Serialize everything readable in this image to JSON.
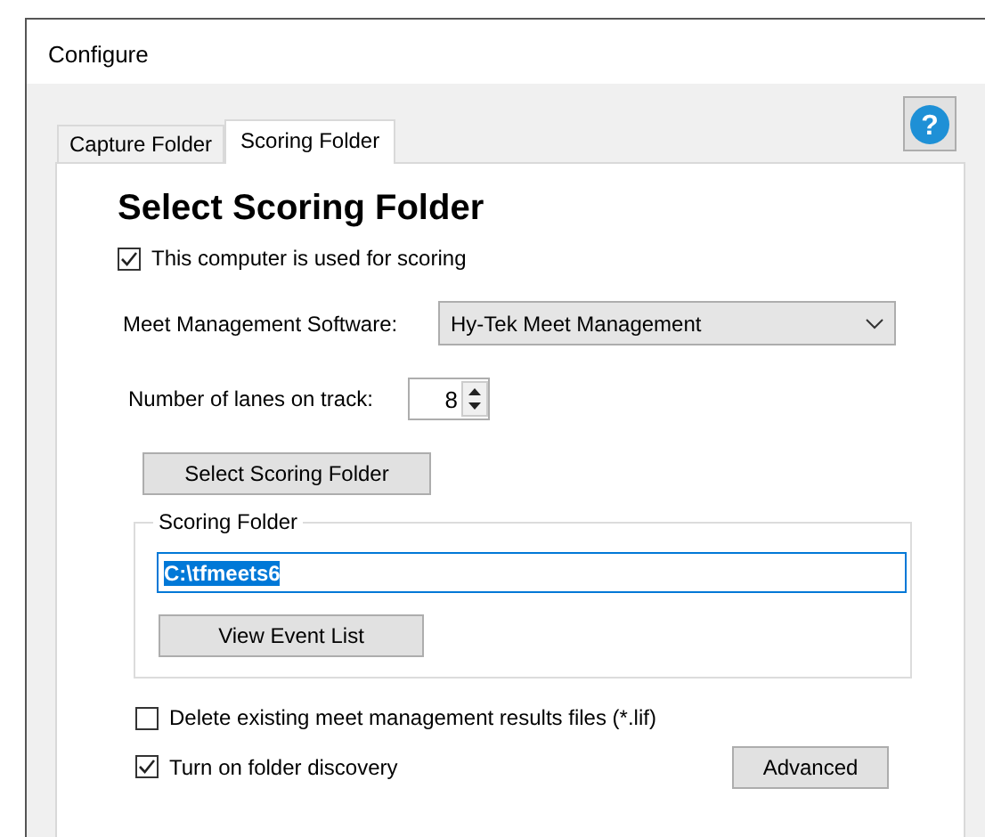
{
  "window": {
    "title": "Configure"
  },
  "help_button": {
    "label": "?"
  },
  "tabs": [
    {
      "label": "Capture Folder",
      "selected": false
    },
    {
      "label": "Scoring Folder",
      "selected": true
    }
  ],
  "heading": "Select Scoring Folder",
  "scoring_checkbox": {
    "label": "This computer is used for scoring",
    "checked": true
  },
  "software": {
    "label": "Meet Management Software:",
    "value": "Hy-Tek Meet Management"
  },
  "lanes": {
    "label": "Number of lanes on track:",
    "value": "8"
  },
  "select_button": "Select Scoring Folder",
  "folder_group": {
    "title": "Scoring Folder",
    "path": "C:\\tfmeets6",
    "path_selected": true,
    "button": "View Event List"
  },
  "delete_checkbox": {
    "label": "Delete existing meet management results files (*.lif)",
    "checked": false
  },
  "discovery_checkbox": {
    "label": "Turn on folder discovery",
    "checked": true
  },
  "advanced_button": "Advanced"
}
